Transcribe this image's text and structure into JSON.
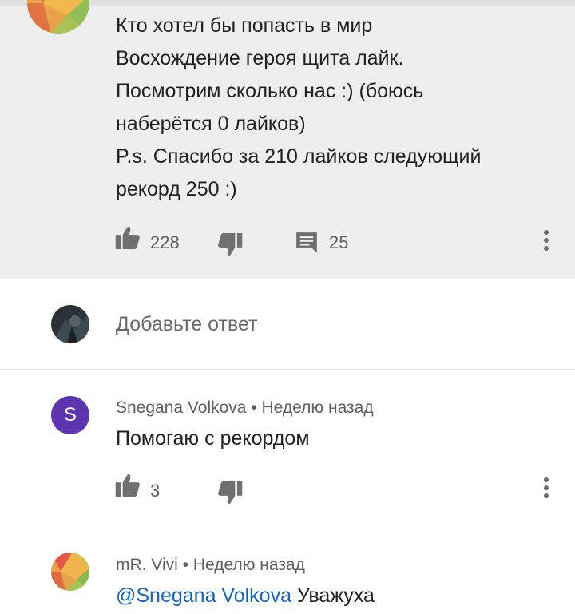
{
  "main_comment": {
    "lines": [
      "Кто хотел бы попасть в мир",
      "Восхождение героя щита лайк.",
      "Посмотрим сколько нас :) (боюсь",
      "наберётся 0 лайков)",
      "P.s. Спасибо за 210 лайков следующий",
      "рекорд 250 :)"
    ],
    "likes": "228",
    "replies": "25",
    "like_icon": "thumbs-up-icon",
    "dislike_icon": "thumbs-down-icon",
    "reply_icon": "reply-comment-icon",
    "more_icon": "more-vert-icon"
  },
  "reply_box": {
    "placeholder": "Добавьте ответ"
  },
  "replies": [
    {
      "avatar_letter": "S",
      "avatar_color": "#5e35b1",
      "author": "Snegana Volkova",
      "separator": "•",
      "time": "Неделю назад",
      "text": "Помогаю с рекордом",
      "likes": "3"
    },
    {
      "author": "mR. Vivi",
      "separator": "•",
      "time": "Неделю назад",
      "mention": "@Snegana Volkova",
      "text": "Уважуха"
    }
  ],
  "colors": {
    "highlight_bg": "#eeeeee",
    "mention": "#1565c0",
    "meta_text": "#606060"
  }
}
